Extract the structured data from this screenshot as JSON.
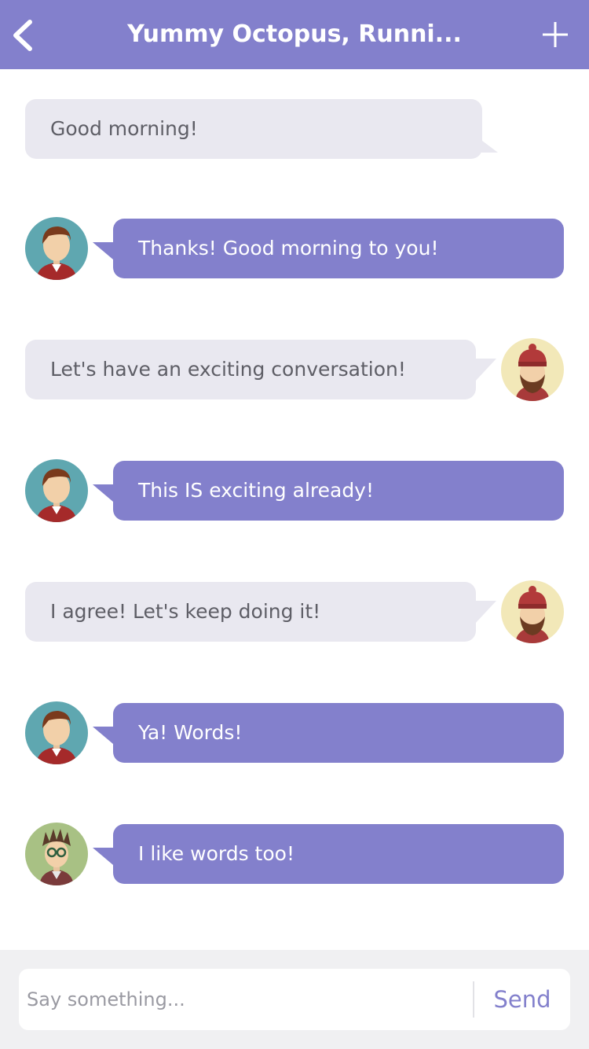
{
  "header": {
    "title": "Yummy Octopus, Runni...",
    "back_icon": "chevron-left-icon",
    "add_icon": "plus-icon"
  },
  "messages": [
    {
      "text": "Good morning!",
      "direction": "outgoing"
    },
    {
      "text": "Thanks! Good morning to you!",
      "direction": "incoming",
      "avatar": "avatar-man-red-sweater"
    },
    {
      "text": "Let's have an exciting conversation!",
      "direction": "outgoing",
      "avatar": "avatar-bearded-beanie"
    },
    {
      "text": "This IS exciting already!",
      "direction": "incoming",
      "avatar": "avatar-man-red-sweater"
    },
    {
      "text": "I agree! Let's keep doing it!",
      "direction": "outgoing",
      "avatar": "avatar-bearded-beanie"
    },
    {
      "text": "Ya! Words!",
      "direction": "incoming",
      "avatar": "avatar-man-red-sweater"
    },
    {
      "text": "I like words too!",
      "direction": "incoming",
      "avatar": "avatar-spiky-hair-glasses"
    }
  ],
  "composer": {
    "placeholder": "Say something...",
    "send_label": "Send"
  },
  "colors": {
    "accent": "#8380cc",
    "outgoing_bubble": "#e9e8f0",
    "outgoing_text": "#5e5e66",
    "footer_bg": "#f0f0f2"
  }
}
